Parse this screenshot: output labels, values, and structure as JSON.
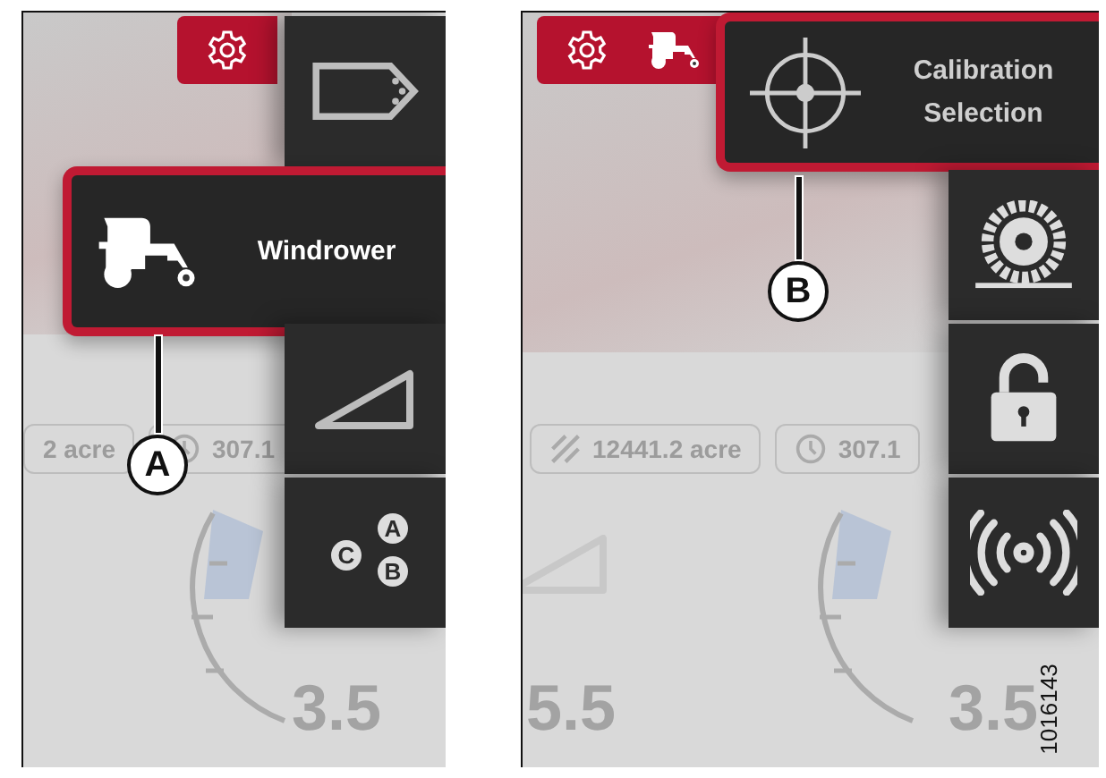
{
  "panels": [
    {
      "callout": "A",
      "status_icons": [
        {
          "kind": "gear"
        }
      ],
      "menu": [
        {
          "kind": "tag",
          "expanded": false
        },
        {
          "kind": "windrower",
          "label": "Windrower",
          "expanded": true
        },
        {
          "kind": "slope",
          "expanded": false
        },
        {
          "kind": "abc",
          "letters": [
            "A",
            "B",
            "C"
          ],
          "expanded": false
        }
      ],
      "readouts": [
        {
          "kind": "plain",
          "value": "2 acre"
        },
        {
          "kind": "time",
          "value": "307.1"
        }
      ],
      "speeds": [
        "3.5"
      ]
    },
    {
      "callout": "B",
      "status_icons": [
        {
          "kind": "gear"
        },
        {
          "kind": "windrower"
        }
      ],
      "menu": [
        {
          "kind": "calibration",
          "label": "Calibration Selection",
          "expanded": true
        },
        {
          "kind": "tire",
          "expanded": false
        },
        {
          "kind": "lock",
          "expanded": false
        },
        {
          "kind": "signal",
          "expanded": false
        }
      ],
      "readouts": [
        {
          "kind": "area",
          "value": "12441.2 acre"
        },
        {
          "kind": "time",
          "value": "307.1"
        }
      ],
      "speeds": [
        "5.5",
        "3.5"
      ],
      "figure_id": "1016143"
    }
  ]
}
